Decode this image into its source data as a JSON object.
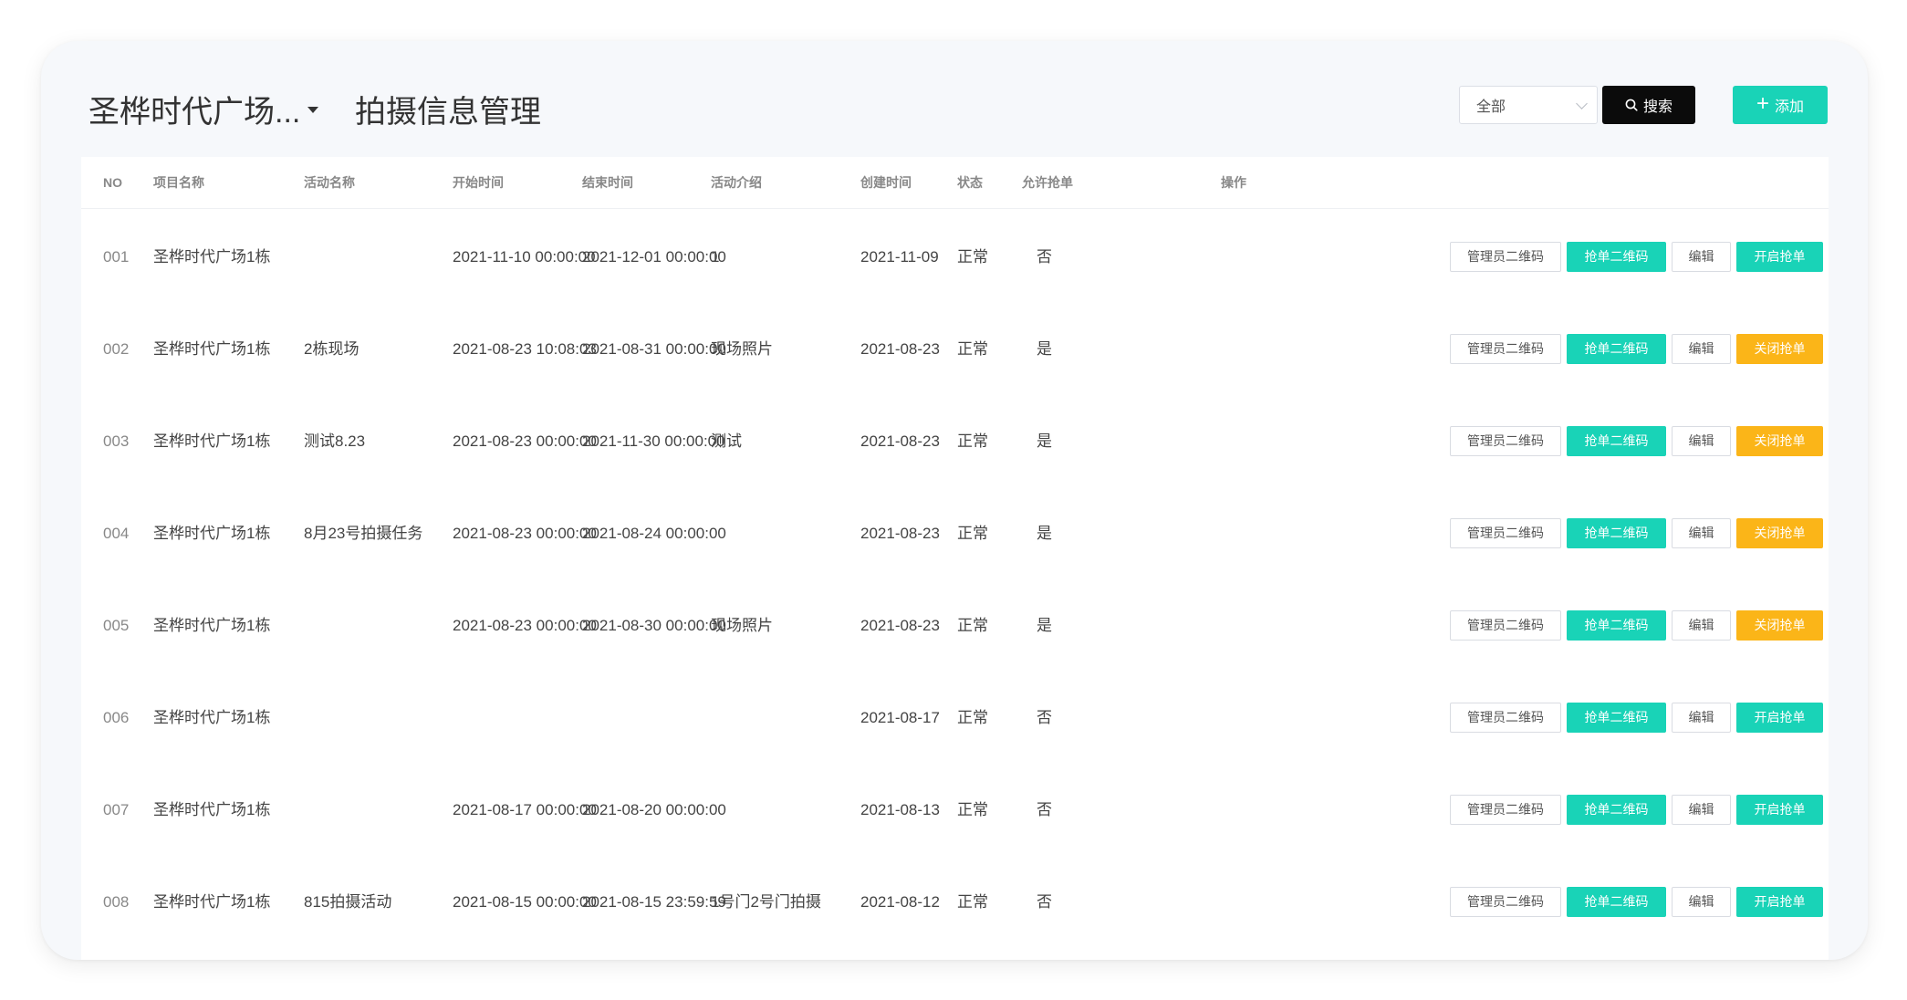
{
  "header": {
    "project_name": "圣桦时代广场...",
    "page_title": "拍摄信息管理",
    "filter": {
      "selected": "全部"
    },
    "search_label": "搜索",
    "add_label": "添加"
  },
  "table": {
    "columns": [
      "NO",
      "项目名称",
      "活动名称",
      "开始时间",
      "结束时间",
      "活动介绍",
      "创建时间",
      "状态",
      "允许抢单",
      "操作"
    ],
    "action_labels": {
      "admin_qr": "管理员二维码",
      "grab_qr": "抢单二维码",
      "edit": "编辑",
      "open_grab": "开启抢单",
      "close_grab": "关闭抢单"
    },
    "rows": [
      {
        "no": "001",
        "project": "圣桦时代广场1栋",
        "activity": "",
        "start": "2021-11-10 00:00:00",
        "end": "2021-12-01 00:00:00",
        "intro": "1",
        "created": "2021-11-09",
        "status": "正常",
        "allow": "否",
        "toggle": "open"
      },
      {
        "no": "002",
        "project": "圣桦时代广场1栋",
        "activity": "2栋现场",
        "start": "2021-08-23 10:08:03",
        "end": "2021-08-31 00:00:00",
        "intro": "现场照片",
        "created": "2021-08-23",
        "status": "正常",
        "allow": "是",
        "toggle": "close"
      },
      {
        "no": "003",
        "project": "圣桦时代广场1栋",
        "activity": "测试8.23",
        "start": "2021-08-23 00:00:00",
        "end": "2021-11-30 00:00:00",
        "intro": "测试",
        "created": "2021-08-23",
        "status": "正常",
        "allow": "是",
        "toggle": "close"
      },
      {
        "no": "004",
        "project": "圣桦时代广场1栋",
        "activity": "8月23号拍摄任务",
        "start": "2021-08-23 00:00:00",
        "end": "2021-08-24 00:00:00",
        "intro": "",
        "created": "2021-08-23",
        "status": "正常",
        "allow": "是",
        "toggle": "close"
      },
      {
        "no": "005",
        "project": "圣桦时代广场1栋",
        "activity": "",
        "start": "2021-08-23 00:00:00",
        "end": "2021-08-30 00:00:00",
        "intro": "现场照片",
        "created": "2021-08-23",
        "status": "正常",
        "allow": "是",
        "toggle": "close"
      },
      {
        "no": "006",
        "project": "圣桦时代广场1栋",
        "activity": "",
        "start": "",
        "end": "",
        "intro": "",
        "created": "2021-08-17",
        "status": "正常",
        "allow": "否",
        "toggle": "open"
      },
      {
        "no": "007",
        "project": "圣桦时代广场1栋",
        "activity": "",
        "start": "2021-08-17 00:00:00",
        "end": "2021-08-20 00:00:00",
        "intro": "",
        "created": "2021-08-13",
        "status": "正常",
        "allow": "否",
        "toggle": "open"
      },
      {
        "no": "008",
        "project": "圣桦时代广场1栋",
        "activity": "815拍摄活动",
        "start": "2021-08-15 00:00:00",
        "end": "2021-08-15 23:59:59",
        "intro": "1号门2号门拍摄",
        "created": "2021-08-12",
        "status": "正常",
        "allow": "否",
        "toggle": "open"
      }
    ]
  },
  "colors": {
    "accent": "#19d3b7",
    "warning": "#fbb518",
    "dark": "#0b0b0b"
  }
}
